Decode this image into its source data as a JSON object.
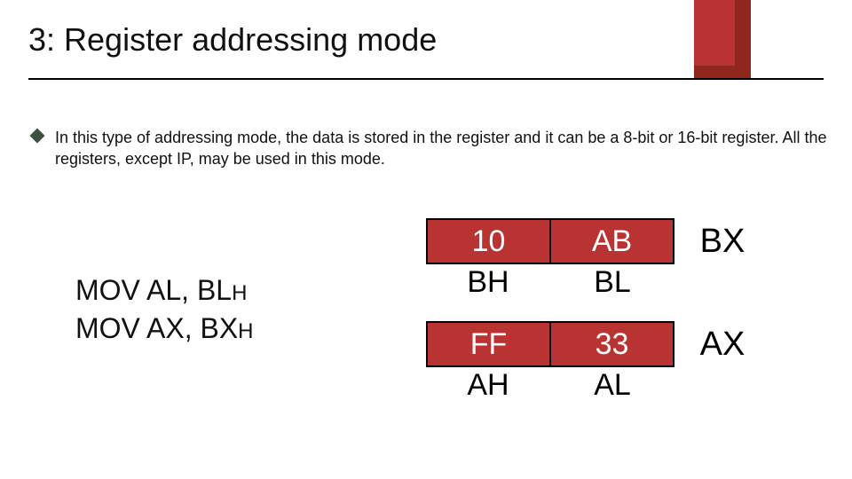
{
  "title": "3: Register addressing mode",
  "bullet_text": "In this type of addressing mode, the data is stored in the register and it can be a 8-bit or 16-bit register. All the registers, except IP, may be used in this mode.",
  "instructions": {
    "line1_main": "MOV AL, BL",
    "line1_suffix": "H",
    "line2_main": "MOV AX, BX",
    "line2_suffix": "H"
  },
  "registers": [
    {
      "name": "BX",
      "high_val": "10",
      "low_val": "AB",
      "high_label": "BH",
      "low_label": "BL"
    },
    {
      "name": "AX",
      "high_val": "FF",
      "low_val": "33",
      "high_label": "AH",
      "low_label": "AL"
    }
  ],
  "colors": {
    "accent": "#b83331",
    "accent_dark": "#8f271c"
  }
}
